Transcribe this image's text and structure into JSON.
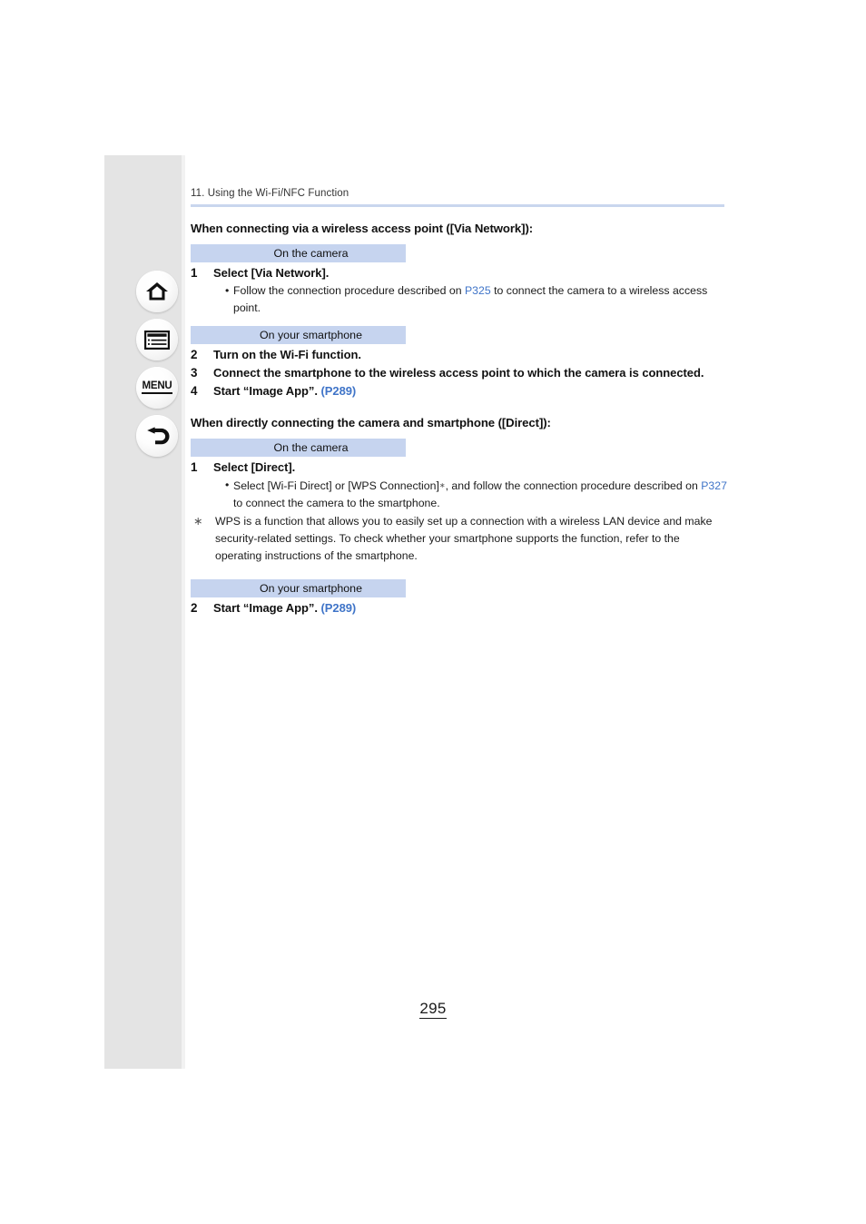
{
  "document": {
    "breadcrumb": "11. Using the Wi-Fi/NFC Function",
    "page_number": "295",
    "link_color": "#3f74c8",
    "label_bg_color": "#c6d4ef",
    "rule_color": "#c9d6ee",
    "sidebar_bg_color": "#e4e4e4"
  },
  "sidebar": {
    "buttons": [
      {
        "name": "home-icon",
        "label": "Home"
      },
      {
        "name": "contents-icon",
        "label": "Table of Contents"
      },
      {
        "name": "menu-icon",
        "label": "MENU"
      },
      {
        "name": "back-icon",
        "label": "Back"
      }
    ],
    "menu_label": "MENU"
  },
  "sections": [
    {
      "heading": "When connecting via a wireless access point ([Via Network]):",
      "blocks": [
        {
          "device_label": "On the camera",
          "steps": [
            {
              "num": "1",
              "text": "Select [Via Network].",
              "bullets": [
                {
                  "dot": "•",
                  "pre": "Follow the connection procedure described on ",
                  "link": "P325",
                  "post": " to connect the camera to a wireless access point."
                }
              ]
            }
          ]
        },
        {
          "device_label": "On your smartphone",
          "steps": [
            {
              "num": "2",
              "text": "Turn on the Wi-Fi function.",
              "bullets": []
            },
            {
              "num": "3",
              "text": "Connect the smartphone to the wireless access point to which the camera is connected.",
              "bullets": []
            },
            {
              "num": "4",
              "text": "Start “Image App”.",
              "link": "(P289)",
              "bullets": []
            }
          ]
        }
      ]
    },
    {
      "heading": "When directly connecting the camera and smartphone ([Direct]):",
      "blocks": [
        {
          "device_label": "On the camera",
          "steps": [
            {
              "num": "1",
              "text": "Select [Direct].",
              "bullets": [
                {
                  "dot": "•",
                  "pre": "Select [Wi-Fi Direct] or [WPS Connection]",
                  "star": "∗",
                  "mid": ", and follow the connection procedure described on ",
                  "link": "P327",
                  "post": " to connect the camera to the smartphone."
                }
              ]
            }
          ],
          "footnote": {
            "mark": "∗",
            "text": "WPS is a function that allows you to easily set up a connection with a wireless LAN device and make security-related settings. To check whether your smartphone supports the function, refer to the operating instructions of the smartphone."
          }
        },
        {
          "device_label": "On your smartphone",
          "steps": [
            {
              "num": "2",
              "text": "Start “Image App”.",
              "link": "(P289)",
              "bullets": []
            }
          ]
        }
      ]
    }
  ]
}
